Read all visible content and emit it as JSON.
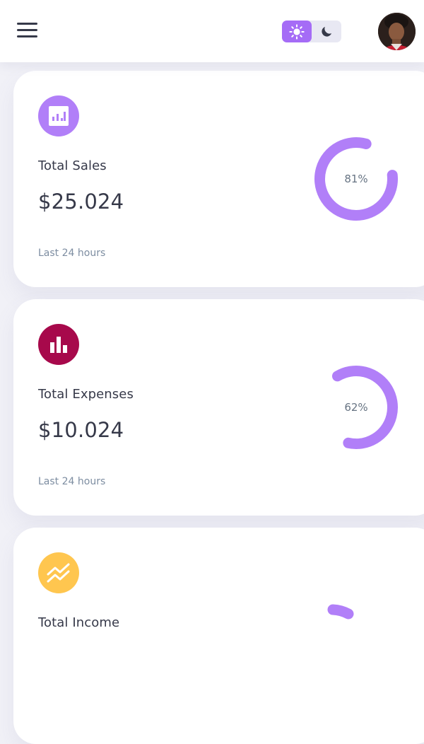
{
  "header": {
    "menu_icon": "hamburger-menu-icon",
    "theme_light_icon": "sun-icon",
    "theme_dark_icon": "moon-icon",
    "accent_color": "#a56cf6",
    "avatar": "profile-photo"
  },
  "cards": [
    {
      "title": "Total Sales",
      "value": "$25.024",
      "footer": "Last 24 hours",
      "percent_label": "81%",
      "percent": 81,
      "icon": "analytics-chart-icon",
      "icon_color": "#b17ff8"
    },
    {
      "title": "Total Expenses",
      "value": "$10.024",
      "footer": "Last 24 hours",
      "percent_label": "62%",
      "percent": 62,
      "icon": "bar-chart-icon",
      "icon_color": "#a7094b"
    },
    {
      "title": "Total Income",
      "value": "",
      "footer": "",
      "percent_label": "",
      "percent": null,
      "icon": "trending-up-icon",
      "icon_color": "#ffc64f"
    }
  ]
}
